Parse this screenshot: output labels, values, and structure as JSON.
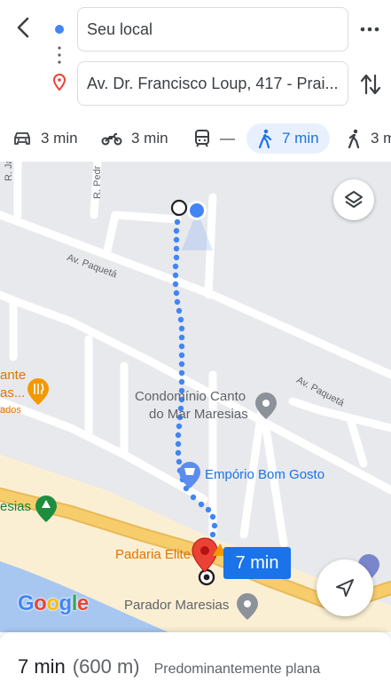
{
  "header": {
    "origin_value": "Seu local",
    "destination_value": "Av. Dr. Francisco Loup, 417 - Prai..."
  },
  "travel_modes": [
    {
      "mode": "car",
      "icon": "car-icon",
      "label": "3 min",
      "selected": false
    },
    {
      "mode": "motorcycle",
      "icon": "motorcycle-icon",
      "label": "3 min",
      "selected": false
    },
    {
      "mode": "transit",
      "icon": "train-icon",
      "label": "—",
      "selected": false
    },
    {
      "mode": "walking",
      "icon": "walk-icon",
      "label": "7 min",
      "selected": true
    },
    {
      "mode": "ride",
      "icon": "ride-icon",
      "label": "3 m",
      "selected": false
    }
  ],
  "map": {
    "street_labels": {
      "r_ja": "R. Ja",
      "r_pedr": "R. Pedr",
      "av_paqueta_1": "Av. Paquetá",
      "av_paqueta_2": "Av. Paquetá"
    },
    "pois": {
      "restaurant_line1": "ante",
      "restaurant_line2": "as...",
      "restaurant_line3": "ados",
      "condominio_line1": "Condomínio Canto",
      "condominio_line2": "do Mar Maresias",
      "emporio": "Empório Bom Gosto",
      "maresias_left": "esias",
      "padaria": "Padaria Elite",
      "parador": "Parador Maresias"
    },
    "eta_badge": "7 min",
    "attribution": "Google",
    "colors": {
      "route": "#4285f4",
      "destination_pin": "#ea4335",
      "land": "#e8e9ed",
      "beach": "#fbefd3",
      "water": "#a7c7f0",
      "road_major": "#f7cd6b"
    }
  },
  "summary": {
    "time": "7 min",
    "distance": "(600 m)",
    "terrain": "Predominantemente plana"
  }
}
